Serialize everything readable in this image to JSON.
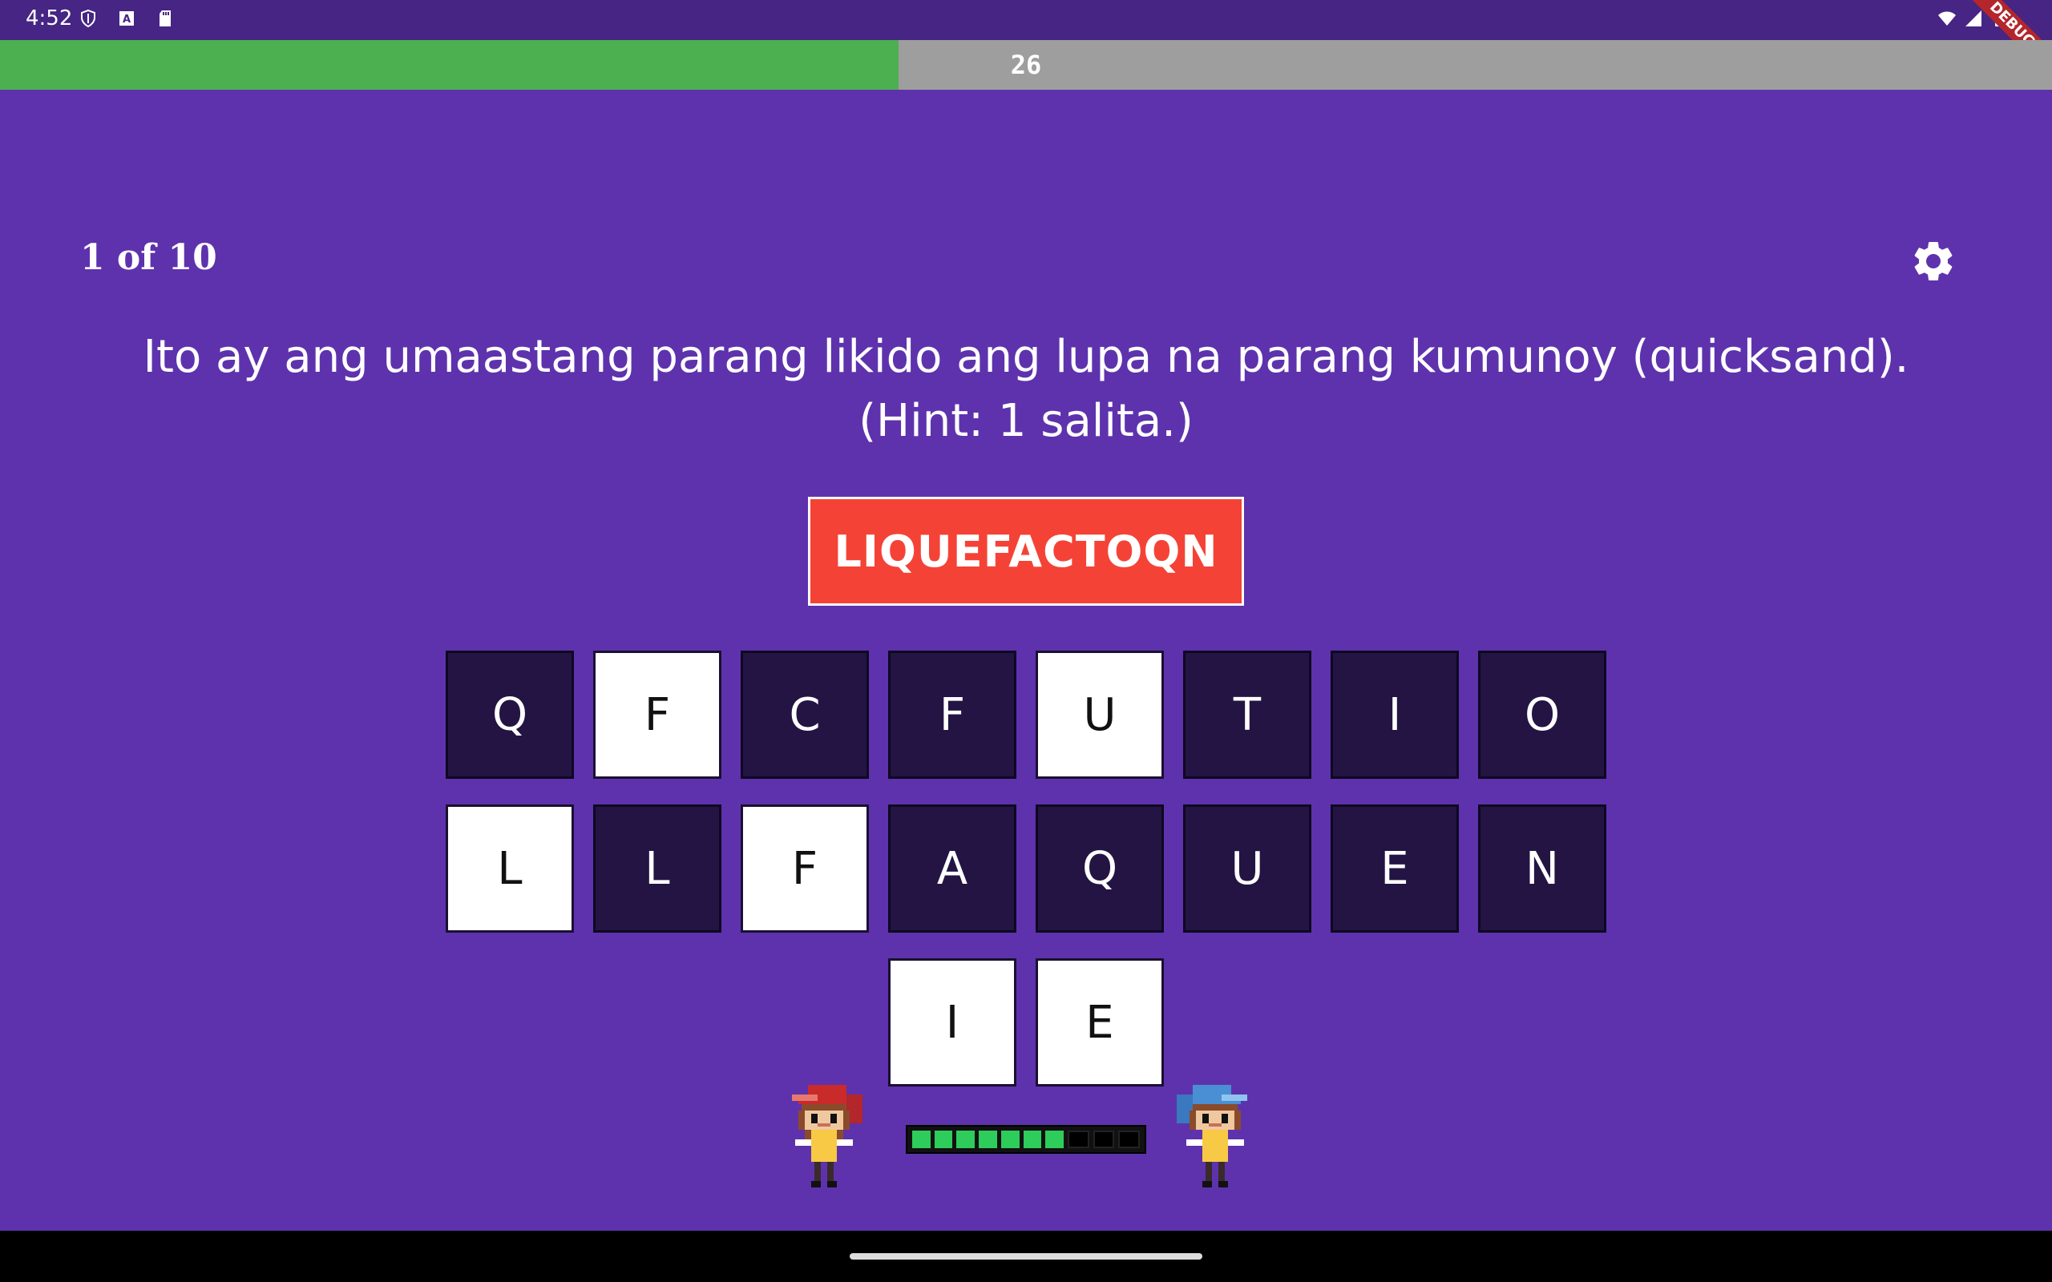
{
  "status_bar": {
    "time": "4:52",
    "debug_label": "DEBUG"
  },
  "timer": {
    "value": "26",
    "fill_fraction": 0.438,
    "fill_color": "#4caf50",
    "track_color": "#9e9e9e"
  },
  "quiz": {
    "progress": "1 of 10",
    "question": "Ito ay ang umaastang parang likido ang lupa na parang kumunoy (quicksand). (Hint: 1 salita.)",
    "answer": "LIQUEFACTOQN"
  },
  "tiles": {
    "row1": [
      {
        "letter": "Q",
        "state": "dark"
      },
      {
        "letter": "F",
        "state": "light"
      },
      {
        "letter": "C",
        "state": "dark"
      },
      {
        "letter": "F",
        "state": "dark"
      },
      {
        "letter": "U",
        "state": "light"
      },
      {
        "letter": "T",
        "state": "dark"
      },
      {
        "letter": "I",
        "state": "dark"
      },
      {
        "letter": "O",
        "state": "dark"
      }
    ],
    "row2": [
      {
        "letter": "L",
        "state": "light"
      },
      {
        "letter": "L",
        "state": "dark"
      },
      {
        "letter": "F",
        "state": "light"
      },
      {
        "letter": "A",
        "state": "dark"
      },
      {
        "letter": "Q",
        "state": "dark"
      },
      {
        "letter": "U",
        "state": "dark"
      },
      {
        "letter": "E",
        "state": "dark"
      },
      {
        "letter": "N",
        "state": "dark"
      }
    ],
    "row3": [
      {
        "letter": "I",
        "state": "light"
      },
      {
        "letter": "E",
        "state": "light"
      }
    ]
  },
  "health": {
    "filled": 7,
    "total": 10
  },
  "icons": {
    "settings": "gear-icon",
    "player_left": "red-hair-player-icon",
    "player_right": "blue-hair-player-icon"
  },
  "colors": {
    "background": "#5e32ad",
    "answer_box": "#f44336",
    "tile_dark": "#241444",
    "tile_light": "#ffffff"
  }
}
